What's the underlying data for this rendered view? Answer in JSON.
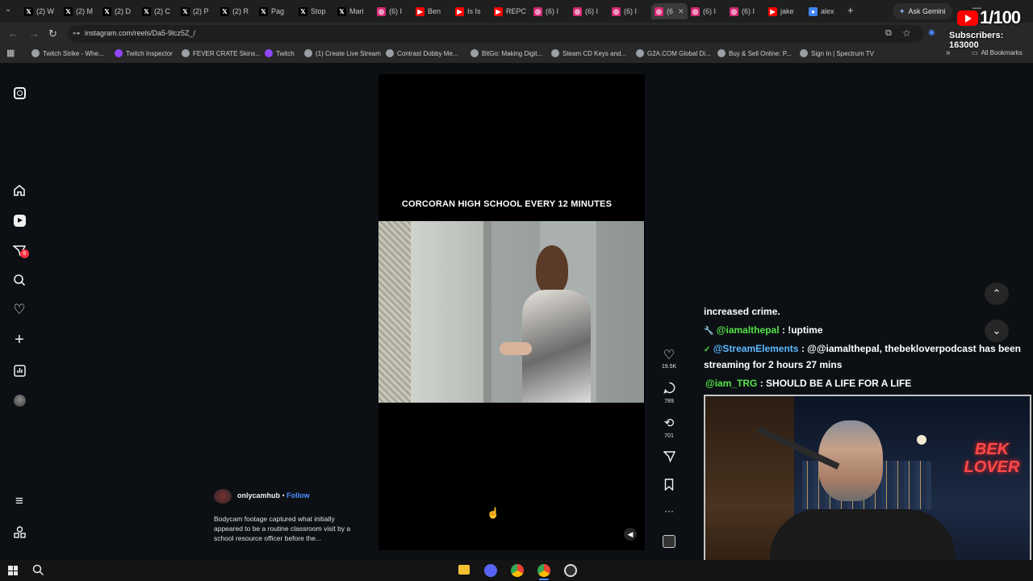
{
  "browser": {
    "tabs": [
      {
        "label": "(2) W",
        "icon": "x-icon"
      },
      {
        "label": "(2) M",
        "icon": "x-icon"
      },
      {
        "label": "(2) D",
        "icon": "x-icon"
      },
      {
        "label": "(2) C",
        "icon": "x-icon"
      },
      {
        "label": "(2) P",
        "icon": "x-icon"
      },
      {
        "label": "(2) R",
        "icon": "x-icon"
      },
      {
        "label": "Pag",
        "icon": "x-icon"
      },
      {
        "label": "Stop",
        "icon": "x-icon"
      },
      {
        "label": "Mari",
        "icon": "x-icon"
      },
      {
        "label": "(6) I",
        "icon": "instagram-icon"
      },
      {
        "label": "Ben",
        "icon": "youtube-icon"
      },
      {
        "label": "Is Is",
        "icon": "youtube-icon"
      },
      {
        "label": "REPC",
        "icon": "youtube-icon"
      },
      {
        "label": "(6) I",
        "icon": "instagram-icon"
      },
      {
        "label": "(6) I",
        "icon": "instagram-icon"
      },
      {
        "label": "(6) I",
        "icon": "instagram-icon"
      },
      {
        "label": "(6",
        "icon": "instagram-icon",
        "active": true
      },
      {
        "label": "(6) I",
        "icon": "instagram-icon"
      },
      {
        "label": "(6) I",
        "icon": "instagram-icon"
      },
      {
        "label": "jake",
        "icon": "youtube-icon"
      },
      {
        "label": "alex",
        "icon": "chrome-icon"
      }
    ],
    "new_tab": "+",
    "ask_gemini": "Ask Gemini",
    "url": "instagram.com/reels/Da5-9lcz5Z_/",
    "bookmarks": [
      {
        "label": "Twitch Strike - Whe...",
        "icon": "globe-icon"
      },
      {
        "label": "Twitch Inspector",
        "icon": "twitch-icon"
      },
      {
        "label": "FEVER CRATE Skins...",
        "icon": "globe-icon"
      },
      {
        "label": "Twitch",
        "icon": "twitch-icon"
      },
      {
        "label": "(1) Create Live Stream",
        "icon": "globe-icon"
      },
      {
        "label": "Contrast Dobby Me...",
        "icon": "globe-icon"
      },
      {
        "label": "BitGo: Making Digit...",
        "icon": "globe-icon"
      },
      {
        "label": "Steam CD Keys and...",
        "icon": "globe-icon"
      },
      {
        "label": "G2A.COM Global Di...",
        "icon": "globe-icon"
      },
      {
        "label": "Buy & Sell Online: P...",
        "icon": "globe-icon"
      },
      {
        "label": "Sign In | Spectrum TV",
        "icon": "globe-icon"
      }
    ],
    "all_bookmarks": "All Bookmarks"
  },
  "stream_overlay": {
    "goal_counter": "1/100",
    "subscribers": "Subscribers: 163000",
    "chat": [
      {
        "user": "",
        "message": "increased crime."
      },
      {
        "user": "@iamalthepal",
        "message": " : !uptime",
        "user_color": "#54e346"
      },
      {
        "user": "@StreamElements",
        "message": " : @@iamalthepal, thebekloverpodcast has been",
        "message_line2": "streaming for 2 hours 27 mins",
        "user_color": "#5bb9ff"
      },
      {
        "user": "@iam_TRG",
        "message": " : SHOULD BE A LIFE FOR A LIFE",
        "user_color": "#54e346"
      }
    ],
    "neon_sign_line1": "BEK",
    "neon_sign_line2": "LOVER"
  },
  "instagram": {
    "sidebar": {
      "notifications_badge": "6"
    },
    "reel": {
      "caption_overlay": "CORCORAN HIGH SCHOOL EVERY 12 MINUTES",
      "author": "onlycamhub",
      "separator": " • ",
      "follow_label": "Follow",
      "description": "Bodycam footage captured what initially appeared to be a routine classroom visit by a school resource officer before the..."
    },
    "actions": {
      "likes": "19.5K",
      "comments": "789",
      "reposts": "701"
    }
  },
  "colors": {
    "accent_blue": "#4a8cff",
    "instagram_badge": "#ff3040",
    "chat_green": "#54e346",
    "chat_blue": "#5bb9ff"
  }
}
